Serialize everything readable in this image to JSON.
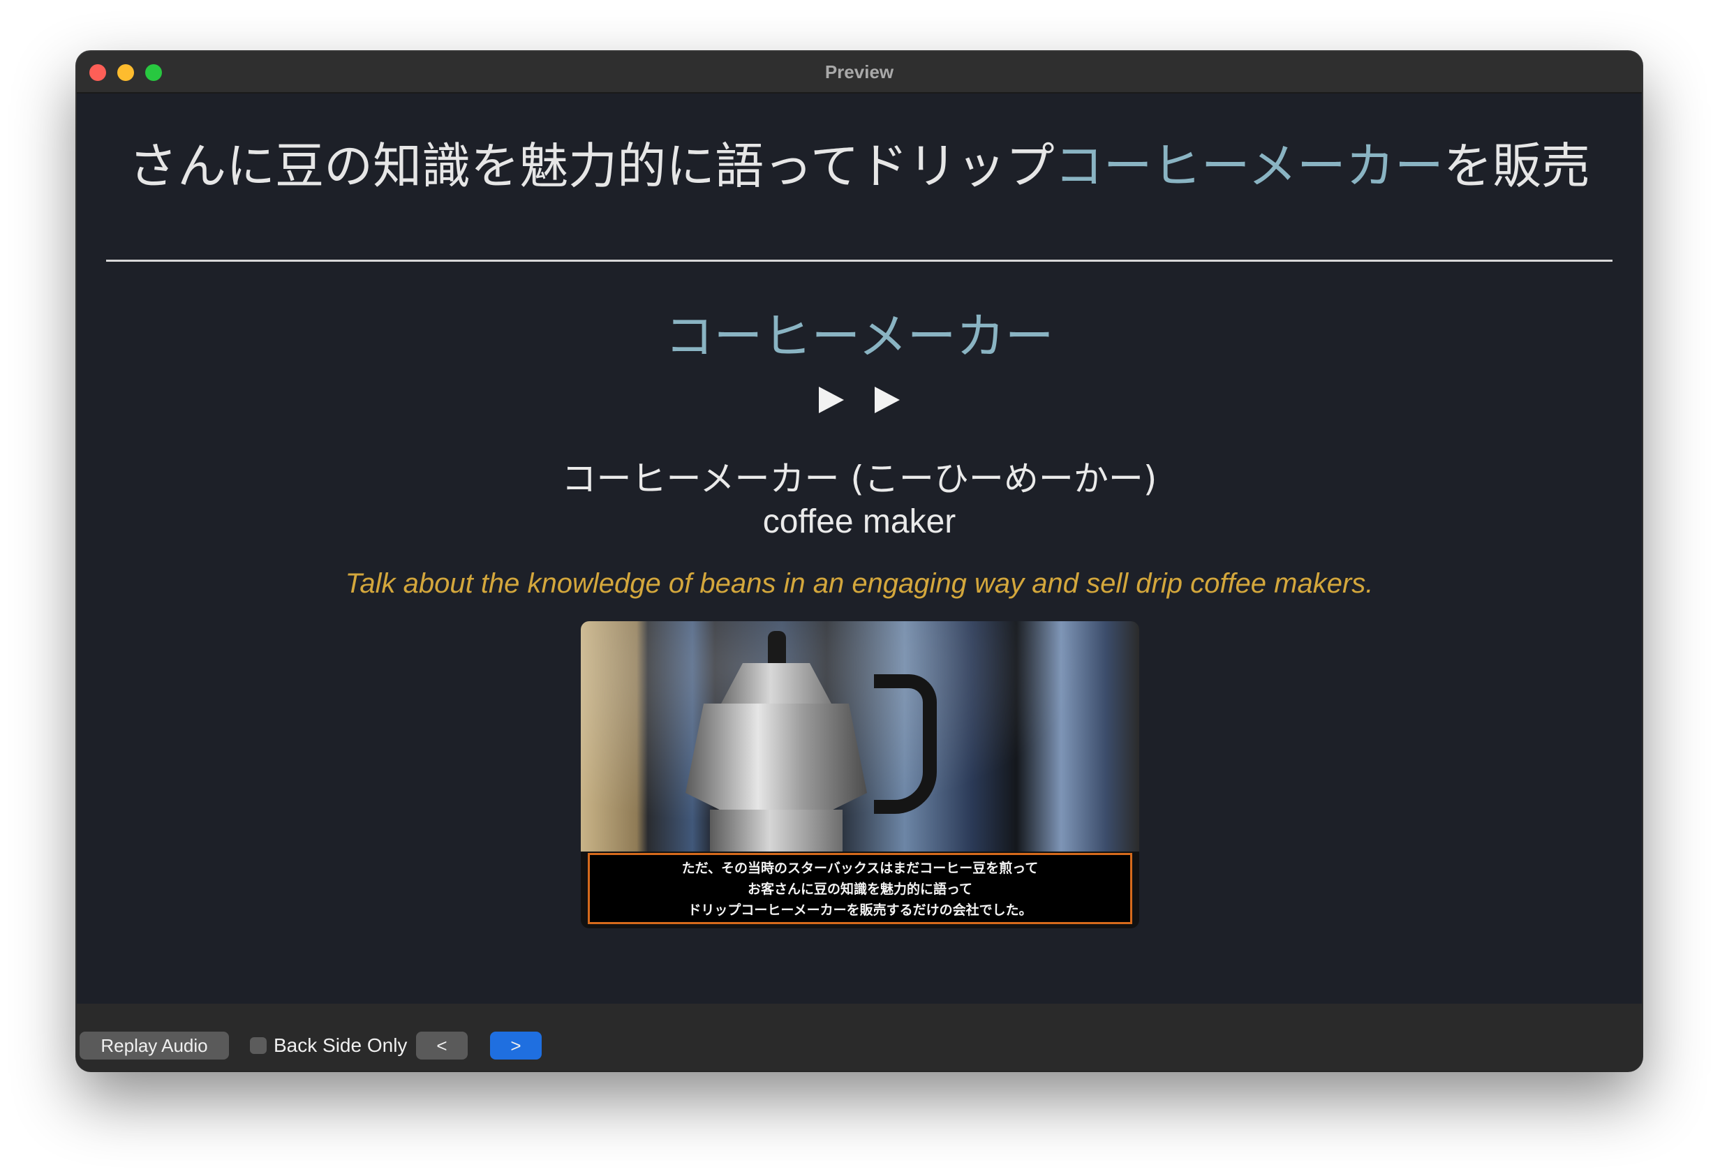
{
  "window": {
    "title": "Preview"
  },
  "card": {
    "front_before": "さんに豆の知識を魅力的に語ってドリップ",
    "front_highlight": "コーヒーメーカー",
    "front_after": "を販売",
    "back_word": "コーヒーメーカー",
    "reading": "コーヒーメーカー (こーひーめーかー)",
    "meaning": "coffee maker",
    "sentence": "Talk about the knowledge of beans in an engaging way and sell drip coffee makers.",
    "image_subtitle": [
      "ただ、その当時のスターバックスはまだコーヒー豆を煎って",
      "お客さんに豆の知識を魅力的に語って",
      "ドリップコーヒーメーカーを販売するだけの会社でした。"
    ]
  },
  "toolbar": {
    "replay_label": "Replay Audio",
    "back_side_label": "Back Side Only",
    "back_side_checked": false,
    "prev_label": "<",
    "next_label": ">"
  },
  "colors": {
    "background": "#1d2028",
    "highlight": "#8ab4c3",
    "sentence": "#d4a73c",
    "next_button": "#1f6fe0"
  },
  "icons": [
    "play-icon",
    "play-icon"
  ]
}
